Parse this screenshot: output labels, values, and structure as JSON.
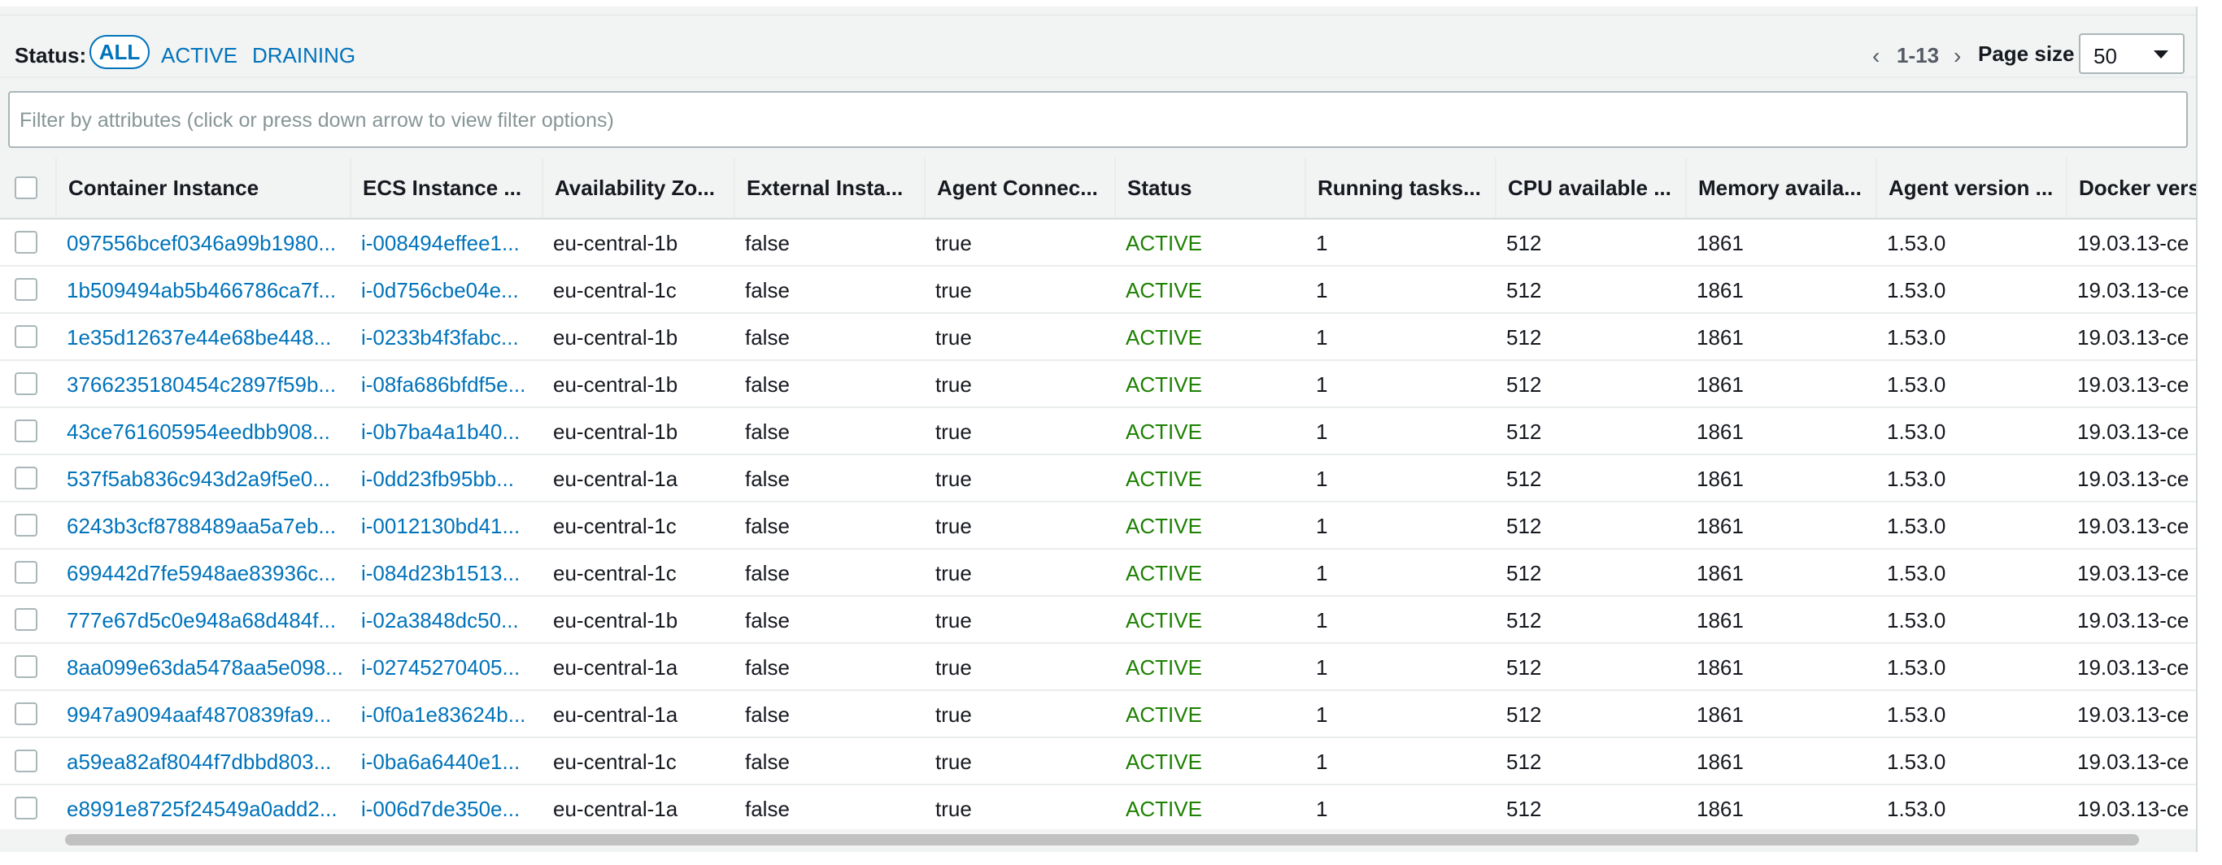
{
  "status_bar": {
    "label": "Status:",
    "filters": [
      "ALL",
      "ACTIVE",
      "DRAINING"
    ],
    "selected_filter": "ALL",
    "pagination": {
      "prev": "‹",
      "range": "1-13",
      "next": "›"
    },
    "page_size_label": "Page size",
    "page_size_value": "50"
  },
  "filter": {
    "placeholder": "Filter by attributes (click or press down arrow to view filter options)"
  },
  "table": {
    "columns": [
      "Container Instance",
      "ECS Instance ...",
      "Availability Zo...",
      "External Insta...",
      "Agent Connec...",
      "Status",
      "Running tasks...",
      "CPU available ...",
      "Memory availa...",
      "Agent version ...",
      "Docker vers"
    ],
    "rows": [
      [
        "097556bcef0346a99b1980...",
        "i-008494effee1...",
        "eu-central-1b",
        "false",
        "true",
        "ACTIVE",
        "1",
        "512",
        "1861",
        "1.53.0",
        "19.03.13-ce"
      ],
      [
        "1b509494ab5b466786ca7f...",
        "i-0d756cbe04e...",
        "eu-central-1c",
        "false",
        "true",
        "ACTIVE",
        "1",
        "512",
        "1861",
        "1.53.0",
        "19.03.13-ce"
      ],
      [
        "1e35d12637e44e68be448...",
        "i-0233b4f3fabc...",
        "eu-central-1b",
        "false",
        "true",
        "ACTIVE",
        "1",
        "512",
        "1861",
        "1.53.0",
        "19.03.13-ce"
      ],
      [
        "3766235180454c2897f59b...",
        "i-08fa686bfdf5e...",
        "eu-central-1b",
        "false",
        "true",
        "ACTIVE",
        "1",
        "512",
        "1861",
        "1.53.0",
        "19.03.13-ce"
      ],
      [
        "43ce761605954eedbb908...",
        "i-0b7ba4a1b40...",
        "eu-central-1b",
        "false",
        "true",
        "ACTIVE",
        "1",
        "512",
        "1861",
        "1.53.0",
        "19.03.13-ce"
      ],
      [
        "537f5ab836c943d2a9f5e0...",
        "i-0dd23fb95bb...",
        "eu-central-1a",
        "false",
        "true",
        "ACTIVE",
        "1",
        "512",
        "1861",
        "1.53.0",
        "19.03.13-ce"
      ],
      [
        "6243b3cf8788489aa5a7eb...",
        "i-0012130bd41...",
        "eu-central-1c",
        "false",
        "true",
        "ACTIVE",
        "1",
        "512",
        "1861",
        "1.53.0",
        "19.03.13-ce"
      ],
      [
        "699442d7fe5948ae83936c...",
        "i-084d23b1513...",
        "eu-central-1c",
        "false",
        "true",
        "ACTIVE",
        "1",
        "512",
        "1861",
        "1.53.0",
        "19.03.13-ce"
      ],
      [
        "777e67d5c0e948a68d484f...",
        "i-02a3848dc50...",
        "eu-central-1b",
        "false",
        "true",
        "ACTIVE",
        "1",
        "512",
        "1861",
        "1.53.0",
        "19.03.13-ce"
      ],
      [
        "8aa099e63da5478aa5e098...",
        "i-02745270405...",
        "eu-central-1a",
        "false",
        "true",
        "ACTIVE",
        "1",
        "512",
        "1861",
        "1.53.0",
        "19.03.13-ce"
      ],
      [
        "9947a9094aaf4870839fa9...",
        "i-0f0a1e83624b...",
        "eu-central-1a",
        "false",
        "true",
        "ACTIVE",
        "1",
        "512",
        "1861",
        "1.53.0",
        "19.03.13-ce"
      ],
      [
        "a59ea82af8044f7dbbd803...",
        "i-0ba6a6440e1...",
        "eu-central-1c",
        "false",
        "true",
        "ACTIVE",
        "1",
        "512",
        "1861",
        "1.53.0",
        "19.03.13-ce"
      ],
      [
        "e8991e8725f24549a0add2...",
        "i-006d7de350e...",
        "eu-central-1a",
        "false",
        "true",
        "ACTIVE",
        "1",
        "512",
        "1861",
        "1.53.0",
        "19.03.13-ce"
      ]
    ]
  },
  "colors": {
    "link": "#0073bb",
    "active_status": "#1d8102",
    "header_bg": "#f2f3f3",
    "border": "#aab7b8"
  }
}
